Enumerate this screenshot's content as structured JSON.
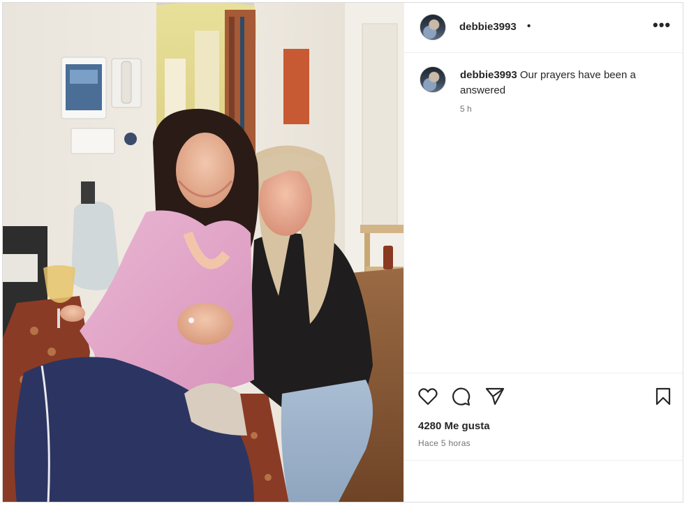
{
  "post": {
    "username": "debbie3993",
    "dot": "•",
    "more": "•••",
    "caption_user": "debbie3993",
    "caption_text": " Our prayers have been a answered",
    "caption_time": "5 h",
    "likes": "4280 Me gusta",
    "time": "Hace 5 horas"
  },
  "icons": {
    "avatar": "avatar",
    "like": "heart-icon",
    "comment": "comment-icon",
    "share": "paper-plane-icon",
    "save": "bookmark-icon",
    "more": "more-options-icon"
  },
  "colors": {
    "text": "#262626",
    "secondary": "#737373",
    "border": "#dbdbdb"
  }
}
